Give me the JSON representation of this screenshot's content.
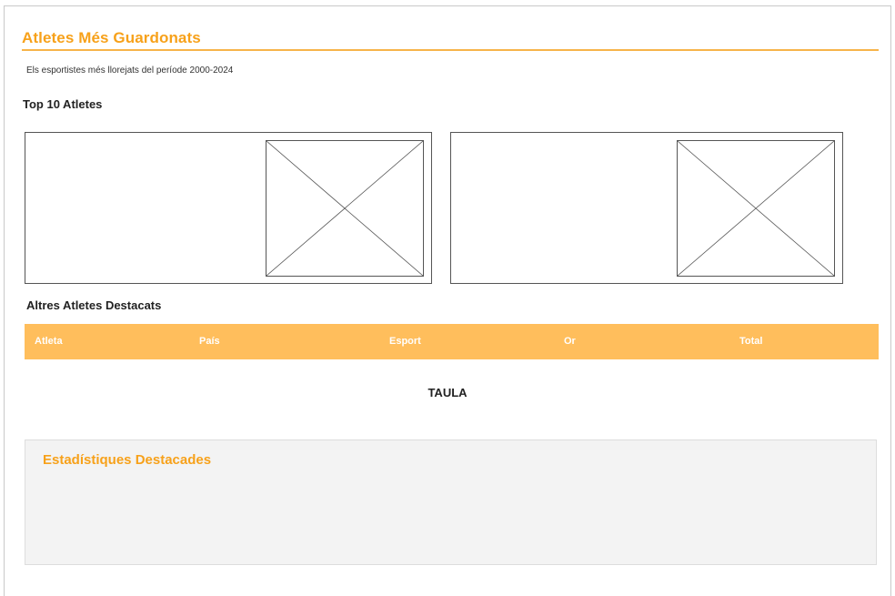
{
  "page": {
    "title": "Atletes Més Guardonats",
    "subtitle": "Els esportistes més llorejats del període 2000-2024"
  },
  "top_section": {
    "heading": "Top 10 Atletes",
    "cards": [
      {
        "image": "image-placeholder"
      },
      {
        "image": "image-placeholder"
      }
    ]
  },
  "others_section": {
    "heading": "Altres Atletes Destacats",
    "table": {
      "columns": [
        "Atleta",
        "País",
        "Esport",
        "Or",
        "Total"
      ],
      "placeholder": "TAULA"
    }
  },
  "stats_section": {
    "title": "Estadístiques Destacades"
  },
  "colors": {
    "accent": "#f7a11a",
    "table_header": "#ffbe5c",
    "stats_background": "#f3f3f3"
  }
}
